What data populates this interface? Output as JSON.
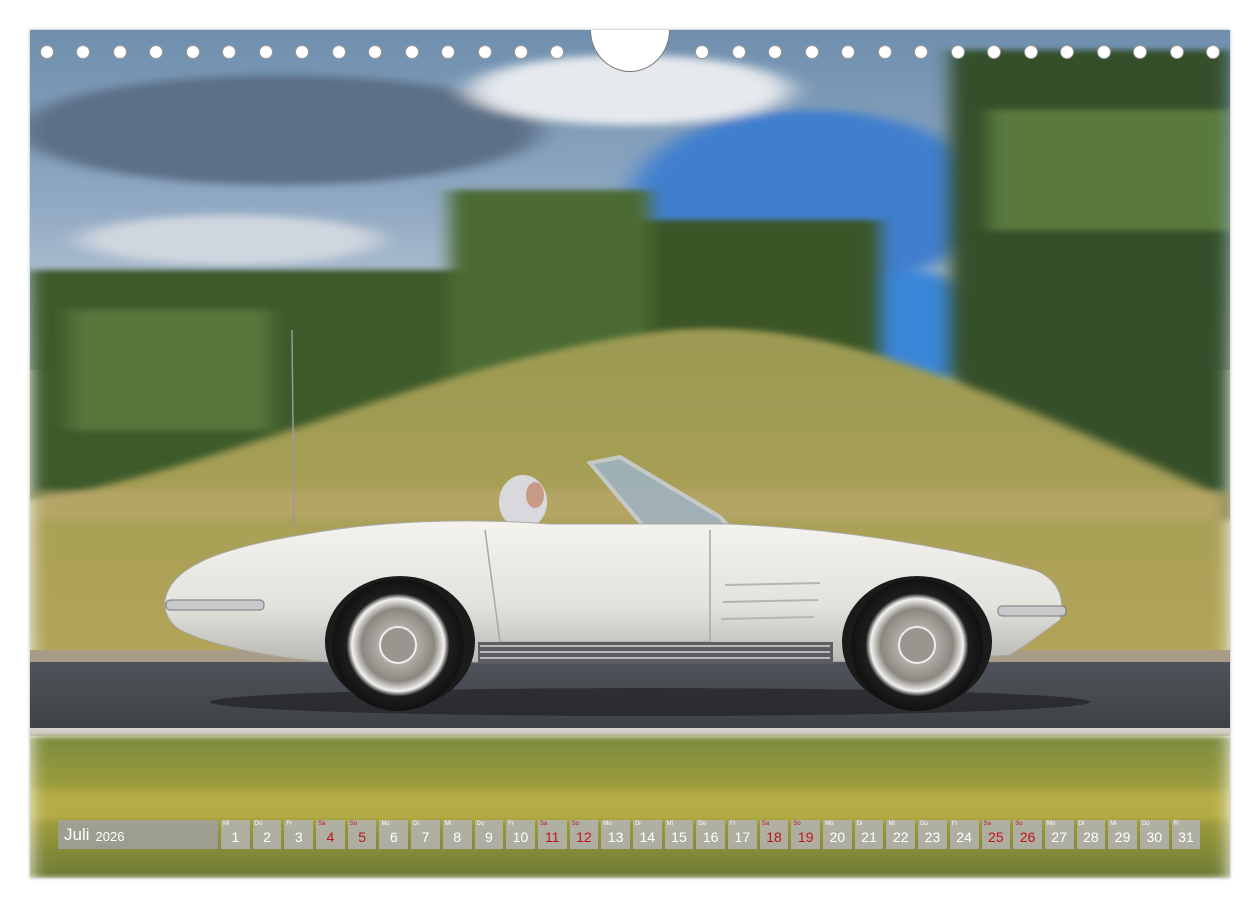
{
  "calendar": {
    "month": "Juli",
    "year": "2026",
    "days": [
      {
        "wd": "Mi",
        "num": "1",
        "weekend": false
      },
      {
        "wd": "Do",
        "num": "2",
        "weekend": false
      },
      {
        "wd": "Fr",
        "num": "3",
        "weekend": false
      },
      {
        "wd": "Sa",
        "num": "4",
        "weekend": true
      },
      {
        "wd": "So",
        "num": "5",
        "weekend": true
      },
      {
        "wd": "Mo",
        "num": "6",
        "weekend": false
      },
      {
        "wd": "Di",
        "num": "7",
        "weekend": false
      },
      {
        "wd": "Mi",
        "num": "8",
        "weekend": false
      },
      {
        "wd": "Do",
        "num": "9",
        "weekend": false
      },
      {
        "wd": "Fr",
        "num": "10",
        "weekend": false
      },
      {
        "wd": "Sa",
        "num": "11",
        "weekend": true
      },
      {
        "wd": "So",
        "num": "12",
        "weekend": true
      },
      {
        "wd": "Mo",
        "num": "13",
        "weekend": false
      },
      {
        "wd": "Di",
        "num": "14",
        "weekend": false
      },
      {
        "wd": "Mi",
        "num": "15",
        "weekend": false
      },
      {
        "wd": "Do",
        "num": "16",
        "weekend": false
      },
      {
        "wd": "Fr",
        "num": "17",
        "weekend": false
      },
      {
        "wd": "Sa",
        "num": "18",
        "weekend": true
      },
      {
        "wd": "So",
        "num": "19",
        "weekend": true
      },
      {
        "wd": "Mo",
        "num": "20",
        "weekend": false
      },
      {
        "wd": "Di",
        "num": "21",
        "weekend": false
      },
      {
        "wd": "Mi",
        "num": "22",
        "weekend": false
      },
      {
        "wd": "Do",
        "num": "23",
        "weekend": false
      },
      {
        "wd": "Fr",
        "num": "24",
        "weekend": false
      },
      {
        "wd": "Sa",
        "num": "25",
        "weekend": true
      },
      {
        "wd": "So",
        "num": "26",
        "weekend": true
      },
      {
        "wd": "Mo",
        "num": "27",
        "weekend": false
      },
      {
        "wd": "Di",
        "num": "28",
        "weekend": false
      },
      {
        "wd": "Mi",
        "num": "29",
        "weekend": false
      },
      {
        "wd": "Do",
        "num": "30",
        "weekend": false
      },
      {
        "wd": "Fr",
        "num": "31",
        "weekend": false
      }
    ]
  },
  "colors": {
    "weekend": "#c0141c",
    "car_body": "#e9e8e2",
    "sky": "#5b8fc4",
    "grass": "#a8a84a"
  }
}
